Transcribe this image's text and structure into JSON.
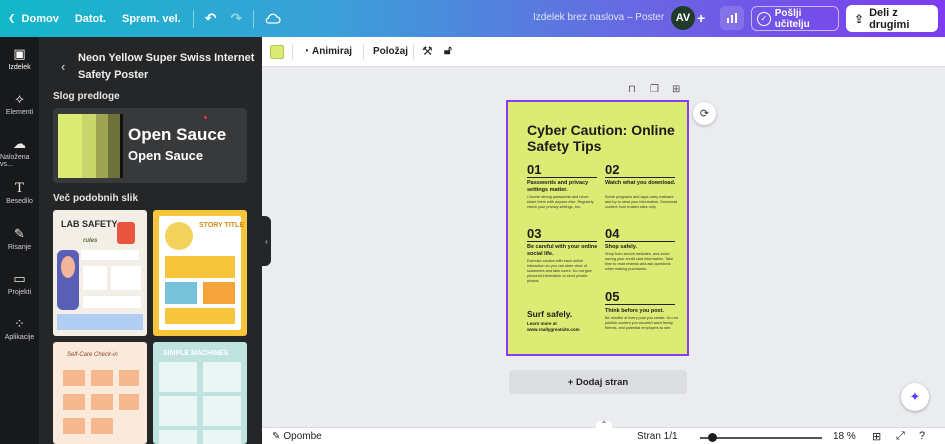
{
  "topbar": {
    "home": "Domov",
    "file": "Datot.",
    "resize": "Sprem. vel.",
    "doc_title": "Izdelek brez naslova – Poster",
    "avatar_initials": "AV",
    "send_label": "Pošlji učitelju",
    "share_label": "Deli z drugimi"
  },
  "rail": {
    "items": [
      {
        "label": "Izdelek",
        "icon": "layout-icon"
      },
      {
        "label": "Elementi",
        "icon": "shapes-icon"
      },
      {
        "label": "Naložena vs...",
        "icon": "cloud-upload-icon"
      },
      {
        "label": "Besedilo",
        "icon": "text-icon"
      },
      {
        "label": "Risanje",
        "icon": "pen-icon"
      },
      {
        "label": "Projekti",
        "icon": "folder-icon"
      },
      {
        "label": "Aplikacije",
        "icon": "apps-icon"
      }
    ]
  },
  "panel": {
    "title": "Neon Yellow Super Swiss Internet Safety Poster",
    "style_section": "Slog predloge",
    "style_font_1": "Open Sauce",
    "style_font_2": "Open Sauce",
    "similar_section": "Več podobnih slik",
    "swatch_colors": [
      "#dceb73",
      "#c9d66b",
      "#9da552",
      "#6d7238",
      "#111111"
    ],
    "thumbs": [
      {
        "title": "LAB SAFETY",
        "subtitle": "rules"
      },
      {
        "title": "STORY TITLE"
      },
      {
        "title": "Self-Care Check-in"
      },
      {
        "title": "SIMPLE MACHINES"
      }
    ]
  },
  "context_toolbar": {
    "animate": "Animiraj",
    "position": "Položaj",
    "color": "#dceb73"
  },
  "poster": {
    "title": "Cyber Caution: Online Safety Tips",
    "tips": [
      {
        "num": "01",
        "head": "Passwords and privacy settings matter.",
        "body": "Choose strong passwords and never share them with anyone else. Regularly check your privacy settings, too."
      },
      {
        "num": "02",
        "head": "Watch what you download.",
        "body": "Some programs and apps carry malware and try to steal your information. Download content from trusted sites only."
      },
      {
        "num": "03",
        "head": "Be careful with your online social life.",
        "body": "Exercise caution with each online interaction so you can steer clear of scammers and fake users. Do not give personal information or send private photos."
      },
      {
        "num": "04",
        "head": "Shop safely.",
        "body": "Shop from secure websites, and avoid saving your credit card information. Take time to read reviews and ask questions when making purchases."
      },
      {
        "num": "05",
        "head": "Think before you post.",
        "body": "Be mindful of every post you create. Do not publish content you wouldn't want family, friends, and potential employers to see."
      }
    ],
    "surf": "Surf safely.",
    "learn": "Learn more at",
    "url": "www.reallygreatsite.com"
  },
  "canvas": {
    "add_page": "+ Dodaj stran"
  },
  "bottombar": {
    "notes": "Opombe",
    "page": "Stran 1/1",
    "zoom": "18 %"
  }
}
